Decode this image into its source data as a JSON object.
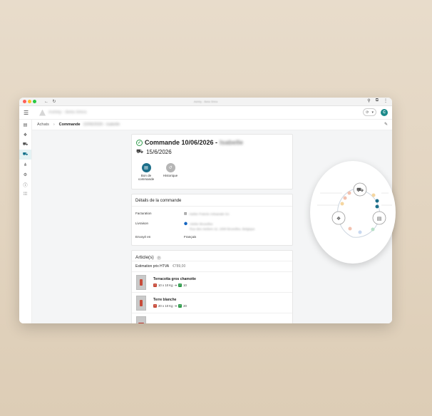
{
  "breadcrumb": {
    "root": "Achats",
    "current": "Commande",
    "blurred": "10/06/2026 - Isabelle"
  },
  "order": {
    "title": "Commande 10/06/2026 -",
    "title_blurred": "Isabelle",
    "delivery_date": "15/6/2026"
  },
  "actions": [
    {
      "label": "Bon de commande",
      "color": "#1d6f8a"
    },
    {
      "label": "Historique",
      "color": "#b5b5b5"
    }
  ],
  "details": {
    "title": "Détails de la commande",
    "facturation_label": "Facturation",
    "facturation_value": "Atelier Poterie Artisanale SA",
    "livraison_label": "Livraison",
    "livraison_line1": "Atelier Bruxelles",
    "livraison_line2": "Rue des Ateliers 12, 1000 Bruxelles, Belgique",
    "envoye_label": "Envoyé en",
    "envoye_value": "Français"
  },
  "articles": {
    "title": "Article(s)",
    "estimation_label": "Estimation prix HTVA",
    "estimation_value": "€789,00",
    "items": [
      {
        "name": "Terracotta gros chamotte",
        "qty": "10 x 10 Kg",
        "badge": "10"
      },
      {
        "name": "Terre blanche",
        "qty": "20 x 10 Kg",
        "badge": "20"
      }
    ]
  },
  "app": {
    "avatar_letter": "C"
  },
  "colors": {
    "accent": "#1b8a8a",
    "success": "#2e9a4a"
  }
}
